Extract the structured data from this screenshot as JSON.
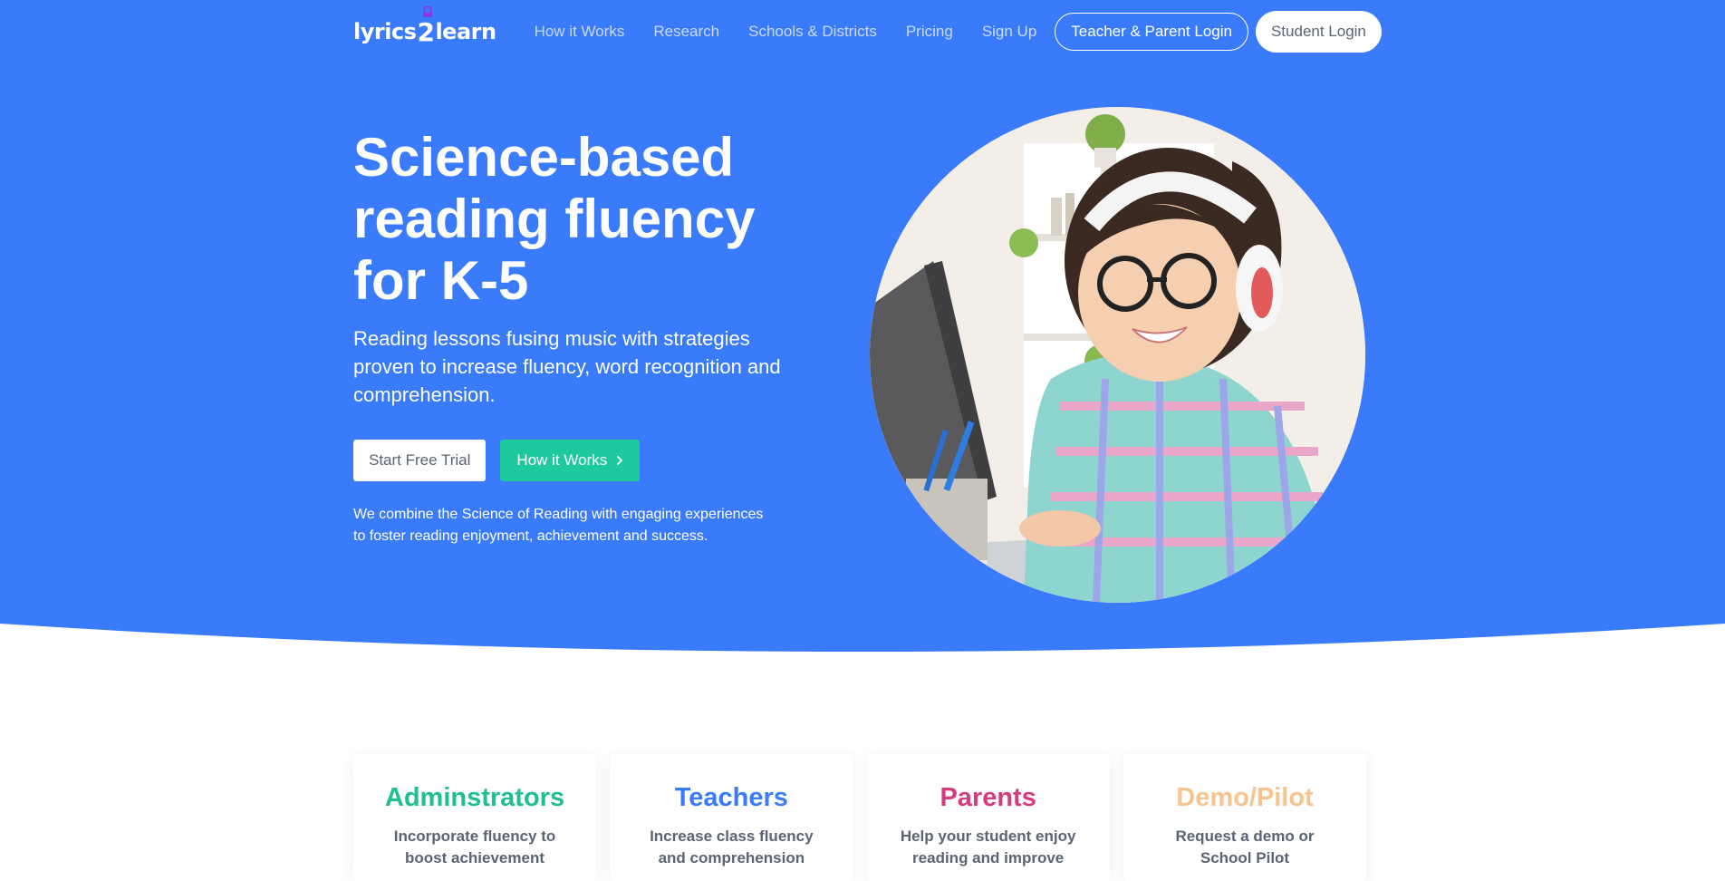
{
  "nav": {
    "logo": {
      "left": "lyrics",
      "two": "2",
      "right": "learn"
    },
    "links": [
      "How it Works",
      "Research",
      "Schools & Districts",
      "Pricing",
      "Sign Up"
    ],
    "teacher_login": "Teacher & Parent Login",
    "student_login": "Student Login"
  },
  "hero": {
    "title": "Science-based reading fluency for K-5",
    "subtitle": "Reading lessons fusing music with strategies proven to increase fluency, word recognition and comprehension.",
    "cta_primary": "Start Free Trial",
    "cta_secondary": "How it Works",
    "note": "We combine the Science of Reading with engaging experiences to foster reading enjoyment, achievement and success."
  },
  "cards": [
    {
      "title": "Adminstrators",
      "desc": "Incorporate fluency to boost achievement",
      "color": "#1fbf8f"
    },
    {
      "title": "Teachers",
      "desc": "Increase class fluency and comprehension",
      "color": "#3a7bfc"
    },
    {
      "title": "Parents",
      "desc": "Help your student enjoy reading and improve",
      "color": "#d63b7e"
    },
    {
      "title": "Demo/Pilot",
      "desc": "Request a demo or School Pilot",
      "color": "#f6c48f"
    }
  ],
  "colors": {
    "hero_bg": "#3a7bfc",
    "accent_green": "#1fc9a0"
  }
}
